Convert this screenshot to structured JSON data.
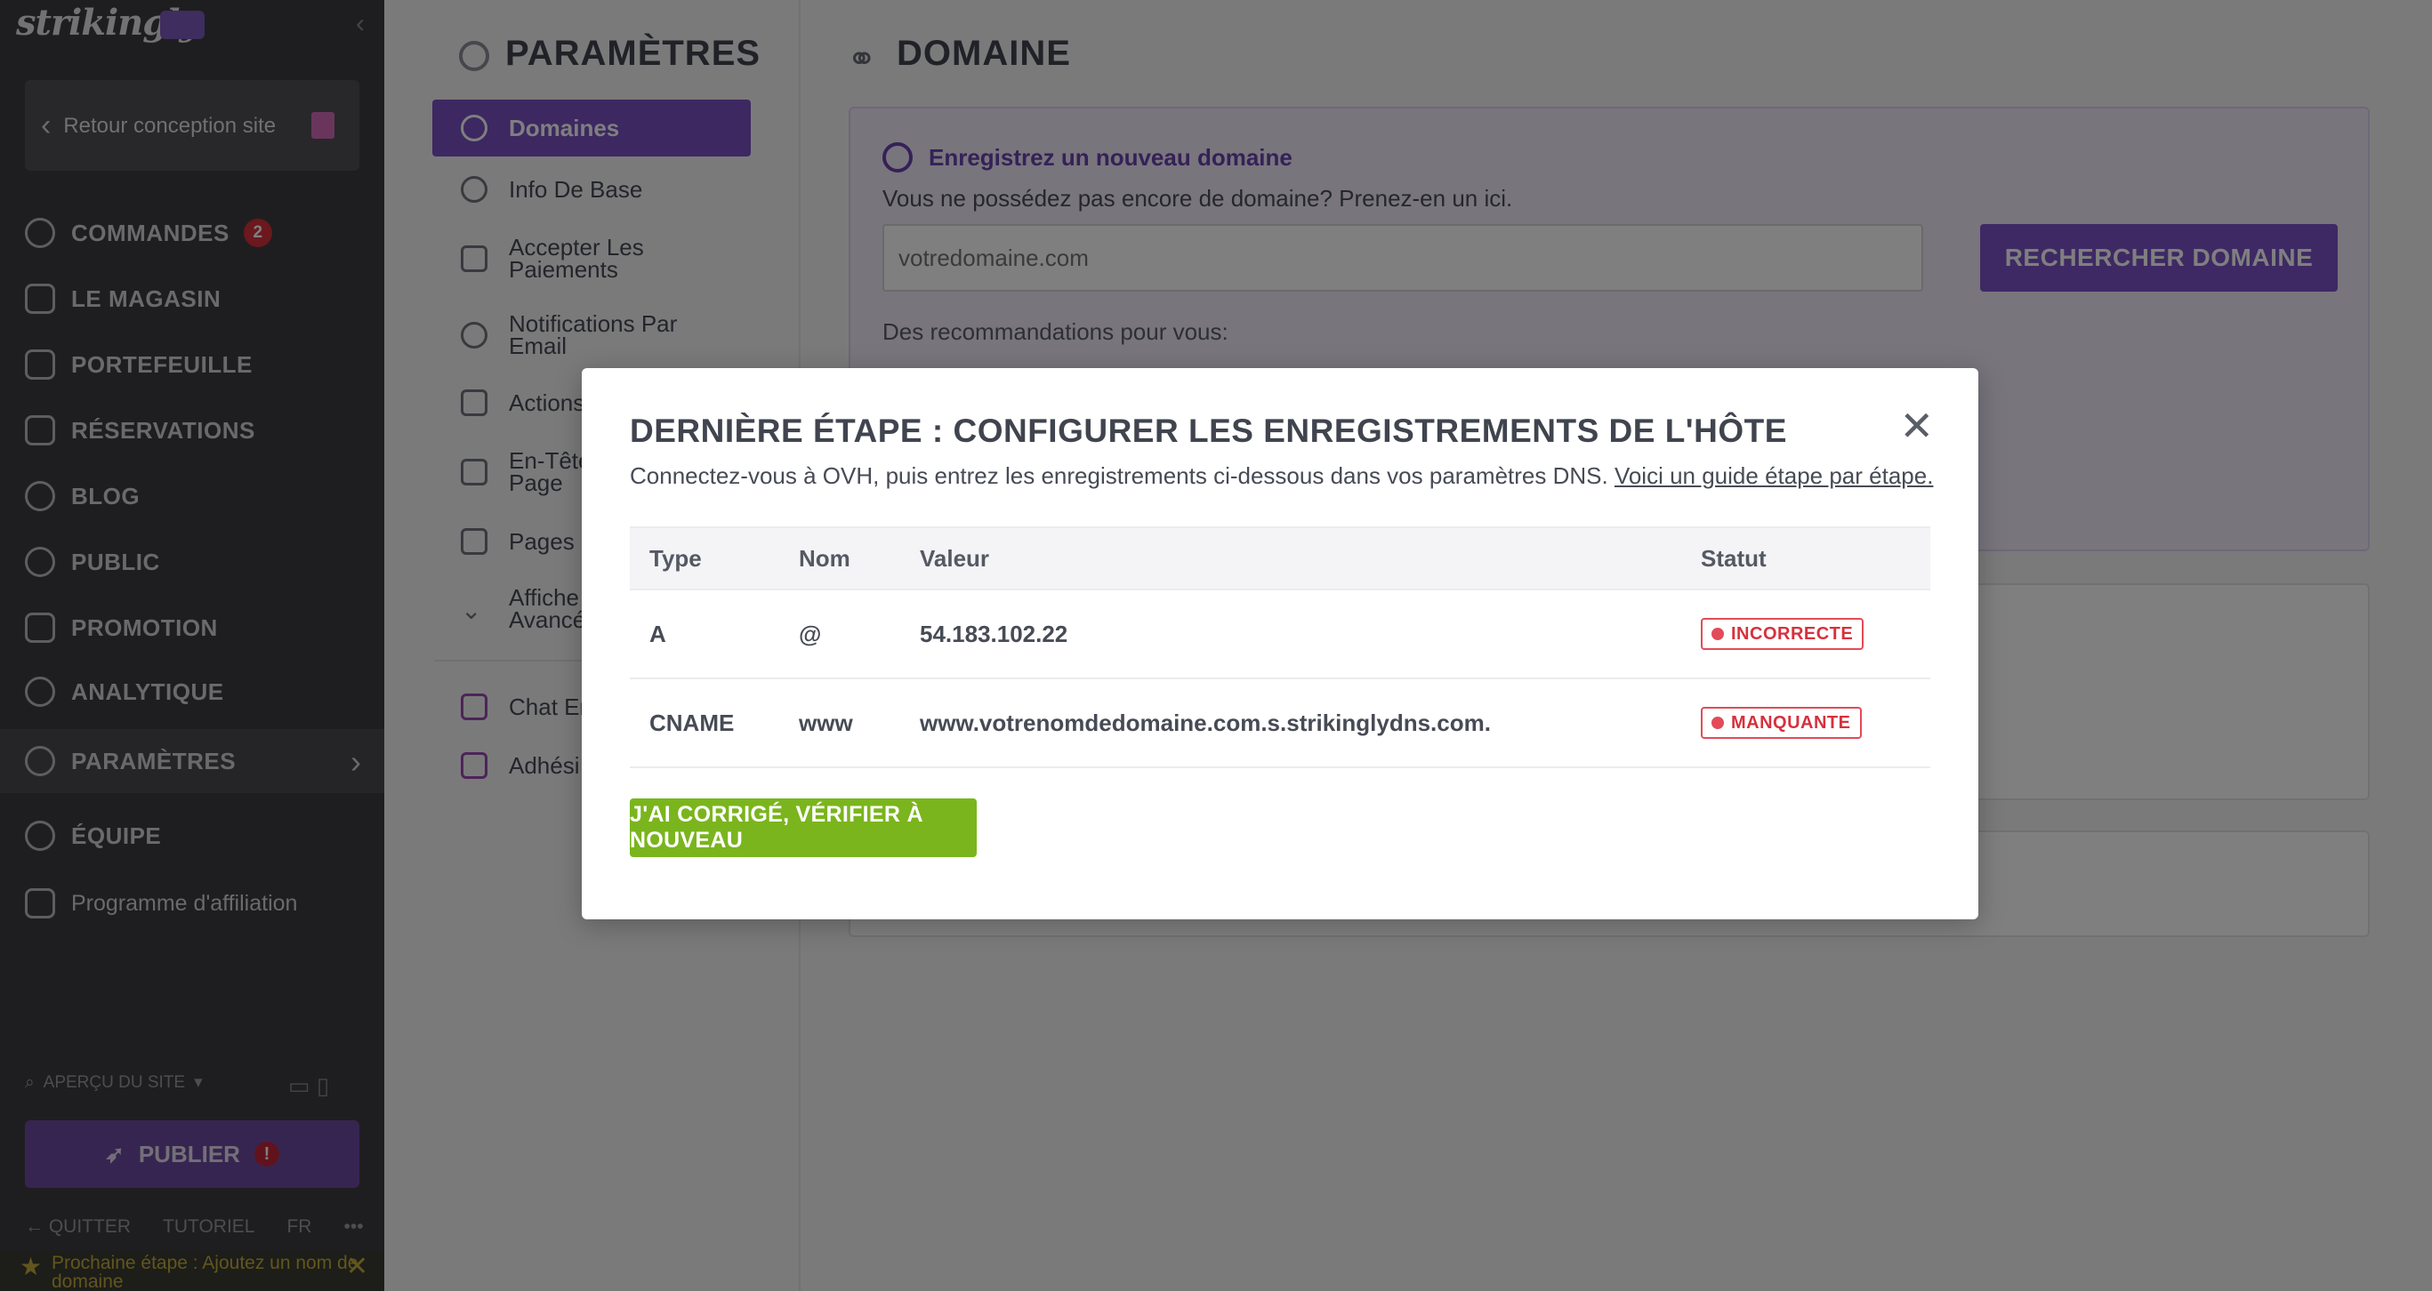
{
  "app": {
    "logo_text": "strikingly"
  },
  "sidebar": {
    "back_label": "Retour conception site",
    "items": [
      {
        "label": "COMMANDES",
        "badge": "2",
        "icon": "dollar-circle-icon"
      },
      {
        "label": "LE MAGASIN",
        "icon": "store-icon"
      },
      {
        "label": "PORTEFEUILLE",
        "icon": "briefcase-icon"
      },
      {
        "label": "RÉSERVATIONS",
        "icon": "calendar-icon"
      },
      {
        "label": "BLOG",
        "icon": "pen-icon"
      },
      {
        "label": "PUBLIC",
        "icon": "users-icon"
      },
      {
        "label": "PROMOTION",
        "icon": "megaphone-icon"
      },
      {
        "label": "ANALYTIQUE",
        "icon": "pie-chart-icon"
      },
      {
        "label": "PARAMÈTRES",
        "icon": "gear-icon",
        "active": true
      },
      {
        "label": "ÉQUIPE",
        "icon": "team-icon"
      },
      {
        "label": "Programme d'affiliation",
        "icon": "trophy-icon"
      }
    ],
    "preview_label": "APERÇU DU SITE",
    "publish_label": "PUBLIER",
    "publish_warning": "!",
    "footer": {
      "quit": "QUITTER",
      "tutorial": "TUTORIEL",
      "language": "FR",
      "more": "•••"
    },
    "next_step": "Prochaine étape : Ajoutez un nom de domaine"
  },
  "settings": {
    "title": "PARAMÈTRES",
    "menu": [
      {
        "label": "Domaines",
        "icon": "globe-icon",
        "active": true
      },
      {
        "label": "Info De Base",
        "icon": "info-icon"
      },
      {
        "label": "Accepter Les Paiements",
        "icon": "card-icon"
      },
      {
        "label": "Notifications Par Email",
        "icon": "bell-icon"
      },
      {
        "label": "Actions",
        "icon": "book-icon"
      },
      {
        "label": "En-Tête Page",
        "icon": "layout-icon"
      },
      {
        "label": "Pages M",
        "icon": "page-icon"
      },
      {
        "label": "Affiche Avancé",
        "icon": "chevron-down-icon"
      },
      {
        "label": "Chat En",
        "icon": "chat-icon"
      },
      {
        "label": "Adhési",
        "icon": "member-icon"
      }
    ]
  },
  "main": {
    "title": "DOMAINE",
    "register": {
      "heading": "Enregistrez un nouveau domaine",
      "subtitle": "Vous ne possédez pas encore de domaine? Prenez-en un ici.",
      "placeholder": "votredomaine.com",
      "search_button": "RECHERCHER DOMAINE",
      "recommendations": "Des recommandations pour vous:"
    }
  },
  "modal": {
    "title": "DERNIÈRE ÉTAPE : CONFIGURER LES ENREGISTREMENTS DE L'HÔTE",
    "description": "Connectez-vous à OVH, puis entrez les enregistrements ci-dessous dans vos paramètres DNS. ",
    "guide_link": "Voici un guide étape par étape.",
    "columns": [
      "Type",
      "Nom",
      "Valeur",
      "Statut"
    ],
    "rows": [
      {
        "type": "A",
        "name": "@",
        "value": "54.183.102.22",
        "status": "INCORRECTE"
      },
      {
        "type": "CNAME",
        "name": "www",
        "value": "www.votrenomdedomaine.com.s.strikinglydns.com.",
        "status": "MANQUANTE"
      }
    ],
    "verify_button": "J'AI CORRIGÉ, VÉRIFIER À NOUVEAU",
    "close_icon": "close-icon"
  },
  "colors": {
    "accent": "#7b50c3",
    "success": "#7ab51d",
    "error": "#d6313d"
  }
}
